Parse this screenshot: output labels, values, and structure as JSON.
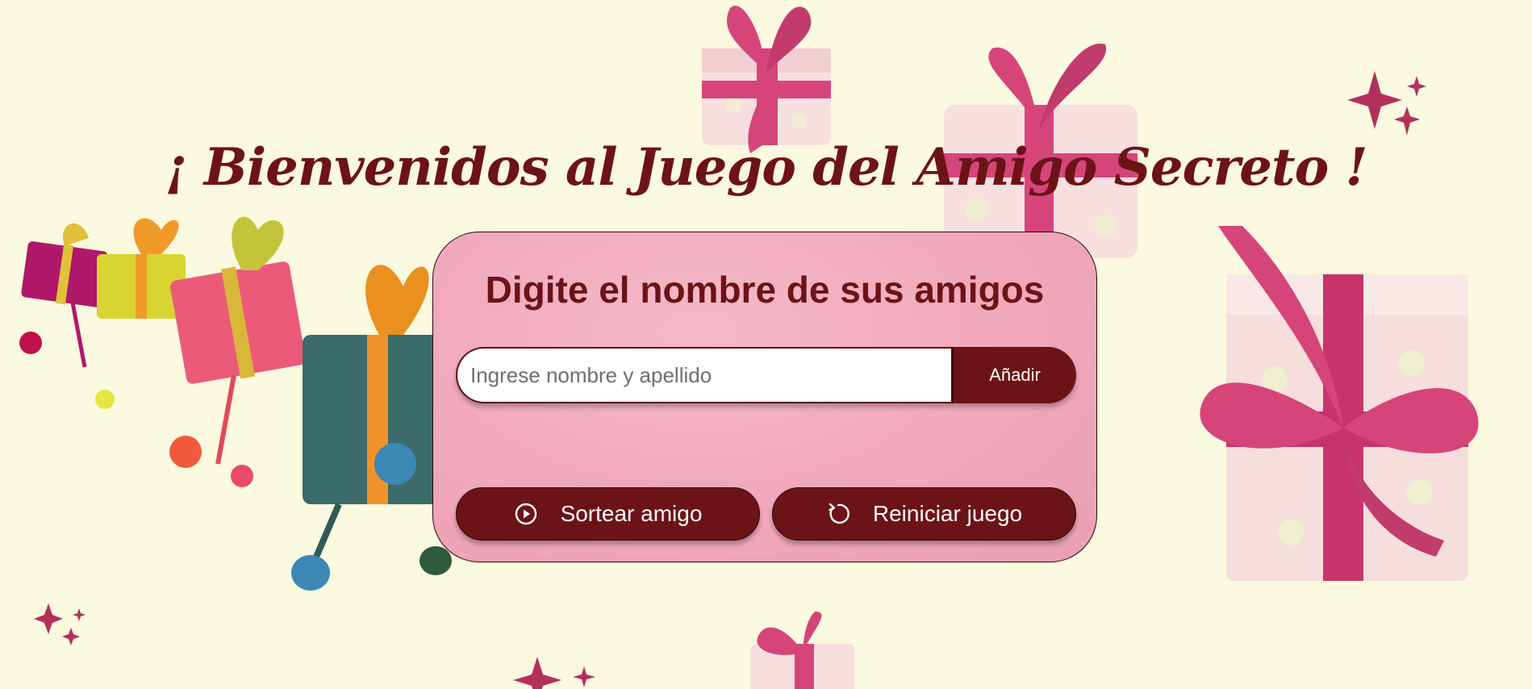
{
  "header": {
    "title": "¡ Bienvenidos al Juego del Amigo Secreto !"
  },
  "card": {
    "heading": "Digite el nombre de sus amigos",
    "name_input": {
      "value": "",
      "placeholder": "Ingrese nombre y apellido"
    },
    "add_label": "Añadir",
    "draw_label": "Sortear amigo",
    "reset_label": "Reiniciar juego"
  },
  "icons": {
    "draw": "play-circle-icon",
    "reset": "refresh-icon",
    "decor": [
      "gift-box-icon",
      "sparkle-icon"
    ]
  },
  "colors": {
    "background": "#fbf9df",
    "primary": "#6c1318",
    "card": "#f0a8ba",
    "ribbon": "#d6457a"
  }
}
